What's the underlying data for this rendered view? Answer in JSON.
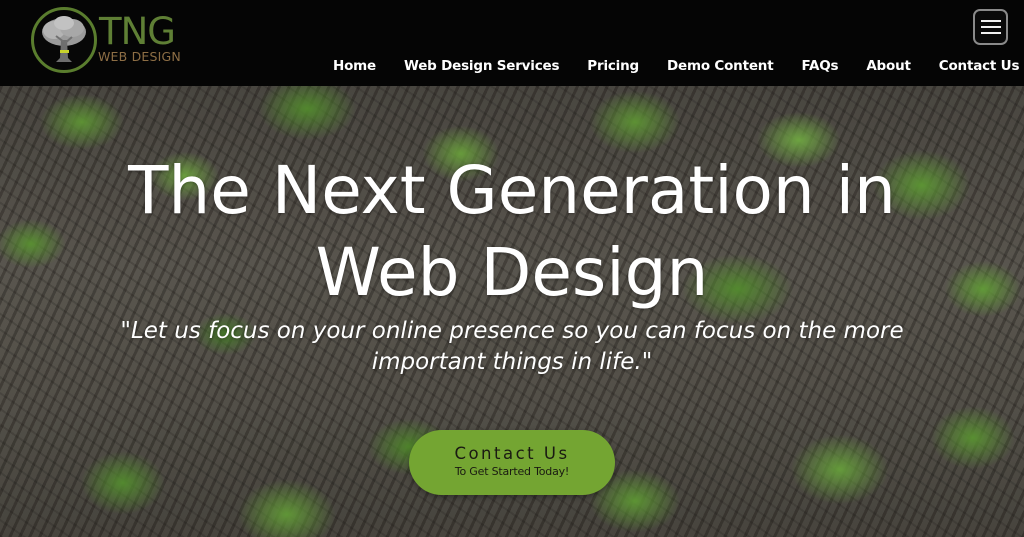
{
  "header": {
    "logo": {
      "title": "TNG",
      "subtitle": "WEB DESIGN",
      "icon": "tree-icon"
    },
    "nav": [
      {
        "label": "Home"
      },
      {
        "label": "Web Design Services"
      },
      {
        "label": "Pricing"
      },
      {
        "label": "Demo Content"
      },
      {
        "label": "FAQs"
      },
      {
        "label": "About"
      },
      {
        "label": "Contact Us"
      }
    ],
    "menu_icon": "hamburger-menu-icon"
  },
  "hero": {
    "title_line1": "The Next Generation in",
    "title_line2": "Web Design",
    "quote_line1": "\"Let us focus on your online presence so you can focus on the more",
    "quote_line2": "important things in life.\"",
    "cta": {
      "label": "Contact Us",
      "sublabel": "To Get Started Today!"
    }
  },
  "colors": {
    "header_bg": "#050505",
    "logo_green": "#5f7f35",
    "logo_brown": "#8d6e45",
    "cta_green": "#74a532",
    "text_white": "#ffffff"
  }
}
